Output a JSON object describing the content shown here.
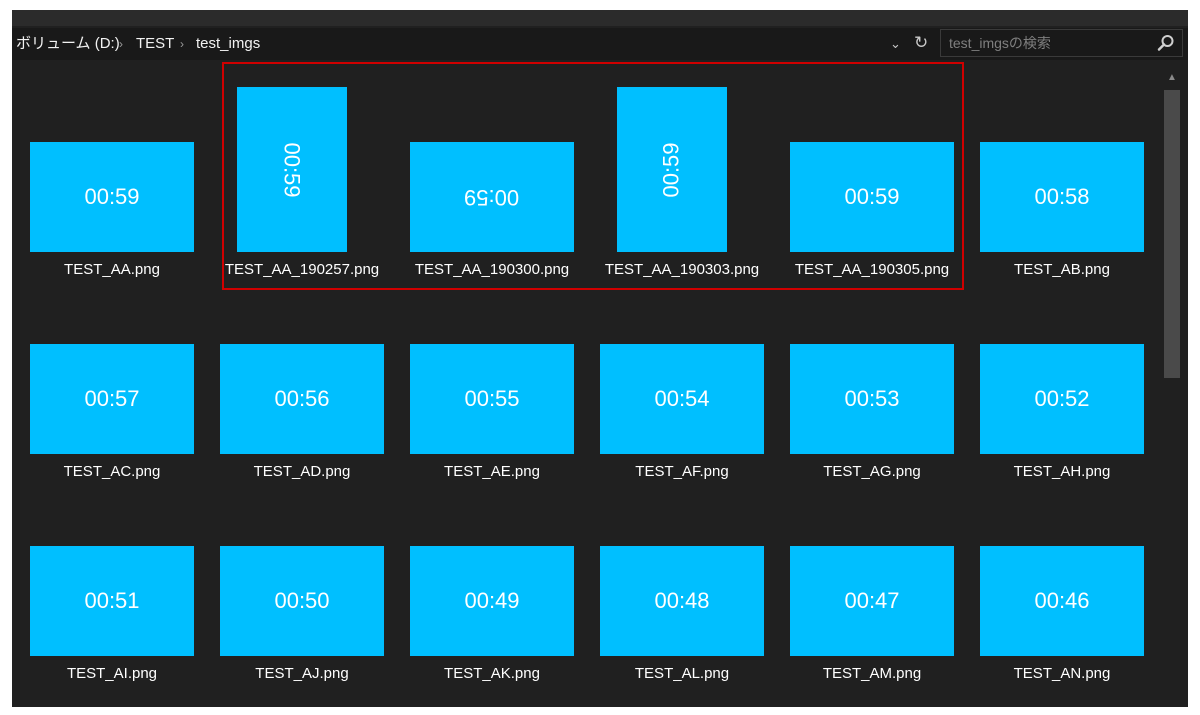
{
  "breadcrumb": {
    "items": [
      "ボリューム (D:)",
      "TEST",
      "test_imgs"
    ]
  },
  "search": {
    "placeholder": "test_imgsの検索"
  },
  "icons": {
    "separator": "chevron-right-icon",
    "dropdown": "chevron-down-icon",
    "refresh": "refresh-icon",
    "search": "search-icon",
    "scroll_up": "scroll-up-icon"
  },
  "colors": {
    "thumbnail": "#00bfff",
    "selection_outline": "#d00000",
    "background": "#202020"
  },
  "files": [
    {
      "name": "TEST_AA.png",
      "thumb_text": "00:59",
      "orientation": "landscape",
      "rotation": 0
    },
    {
      "name": "TEST_AA_190257.png",
      "thumb_text": "00:59",
      "orientation": "portrait",
      "rotation": 90
    },
    {
      "name": "TEST_AA_190300.png",
      "thumb_text": "00:59",
      "orientation": "landscape",
      "rotation": 180
    },
    {
      "name": "TEST_AA_190303.png",
      "thumb_text": "00:59",
      "orientation": "portrait",
      "rotation": 270
    },
    {
      "name": "TEST_AA_190305.png",
      "thumb_text": "00:59",
      "orientation": "landscape",
      "rotation": 0
    },
    {
      "name": "TEST_AB.png",
      "thumb_text": "00:58",
      "orientation": "landscape",
      "rotation": 0
    },
    {
      "name": "TEST_AC.png",
      "thumb_text": "00:57",
      "orientation": "landscape",
      "rotation": 0
    },
    {
      "name": "TEST_AD.png",
      "thumb_text": "00:56",
      "orientation": "landscape",
      "rotation": 0
    },
    {
      "name": "TEST_AE.png",
      "thumb_text": "00:55",
      "orientation": "landscape",
      "rotation": 0
    },
    {
      "name": "TEST_AF.png",
      "thumb_text": "00:54",
      "orientation": "landscape",
      "rotation": 0
    },
    {
      "name": "TEST_AG.png",
      "thumb_text": "00:53",
      "orientation": "landscape",
      "rotation": 0
    },
    {
      "name": "TEST_AH.png",
      "thumb_text": "00:52",
      "orientation": "landscape",
      "rotation": 0
    },
    {
      "name": "TEST_AI.png",
      "thumb_text": "00:51",
      "orientation": "landscape",
      "rotation": 0
    },
    {
      "name": "TEST_AJ.png",
      "thumb_text": "00:50",
      "orientation": "landscape",
      "rotation": 0
    },
    {
      "name": "TEST_AK.png",
      "thumb_text": "00:49",
      "orientation": "landscape",
      "rotation": 0
    },
    {
      "name": "TEST_AL.png",
      "thumb_text": "00:48",
      "orientation": "landscape",
      "rotation": 0
    },
    {
      "name": "TEST_AM.png",
      "thumb_text": "00:47",
      "orientation": "landscape",
      "rotation": 0
    },
    {
      "name": "TEST_AN.png",
      "thumb_text": "00:46",
      "orientation": "landscape",
      "rotation": 0
    }
  ]
}
